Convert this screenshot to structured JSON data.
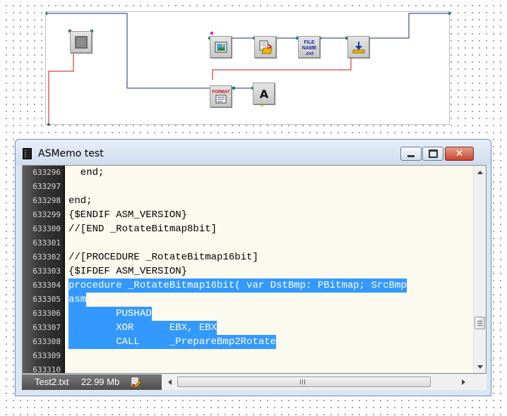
{
  "diagram": {
    "nodes": [
      {
        "id": "stop",
        "icon": "stop-square-icon"
      },
      {
        "id": "image",
        "icon": "image-picture-icon"
      },
      {
        "id": "open-folder",
        "icon": "document-folder-icon"
      },
      {
        "id": "file-name",
        "icon": "file-name-icon",
        "text_line1": "FILE",
        "text_line2": "NAME",
        "text_line3": ".ext"
      },
      {
        "id": "download",
        "icon": "download-arrow-icon"
      },
      {
        "id": "format",
        "icon": "format-icon",
        "text": "FORMAT"
      },
      {
        "id": "text-a",
        "icon": "text-letter-icon",
        "text": "A"
      }
    ],
    "colors": {
      "wire_blue": "#1a2a8c",
      "wire_red": "#cc1111",
      "port_teal": "#1a7a78",
      "port_yellow": "#e8e000",
      "port_magenta": "#e01ee0"
    }
  },
  "window": {
    "title": "ASMemo test",
    "buttons": {
      "minimize": "minimize",
      "maximize": "maximize",
      "close": "✕"
    }
  },
  "editor": {
    "lines": [
      {
        "num": "633296",
        "text": "  end;",
        "selected": false
      },
      {
        "num": "633297",
        "text": "",
        "selected": false
      },
      {
        "num": "633298",
        "text": "end;",
        "selected": false
      },
      {
        "num": "633299",
        "text": "{$ENDIF ASM_VERSION}",
        "selected": false
      },
      {
        "num": "633300",
        "text": "//[END _RotateBitmap8bit]",
        "selected": false
      },
      {
        "num": "633301",
        "text": "",
        "selected": false
      },
      {
        "num": "633302",
        "text": "//[PROCEDURE _RotateBitmap16bit]",
        "selected": false
      },
      {
        "num": "633303",
        "text": "{$IFDEF ASM_VERSION}",
        "selected": false
      },
      {
        "num": "633304",
        "text": "procedure _RotateBitmap16bit( var DstBmp: PBitmap; SrcBmp",
        "selected": true
      },
      {
        "num": "633305",
        "text": "asm",
        "selected": true
      },
      {
        "num": "633306",
        "text": "        PUSHAD",
        "selected": true
      },
      {
        "num": "633307",
        "text": "        XOR      EBX, EBX",
        "selected": true
      },
      {
        "num": "633308",
        "text": "        CALL     _PrepareBmp2Rotate",
        "selected": true
      },
      {
        "num": "633309",
        "text": "",
        "selected": false
      },
      {
        "num": "633310",
        "text": "",
        "selected": false
      }
    ],
    "selection_color": "#3399ff",
    "background": "#fcf9ee"
  },
  "status": {
    "file_name": "Test2.txt",
    "file_size": "22.99 Mb",
    "icon": "document-edit-icon"
  },
  "scrollbars": {
    "vertical_position": 0.82,
    "horizontal_position": 0.0
  }
}
